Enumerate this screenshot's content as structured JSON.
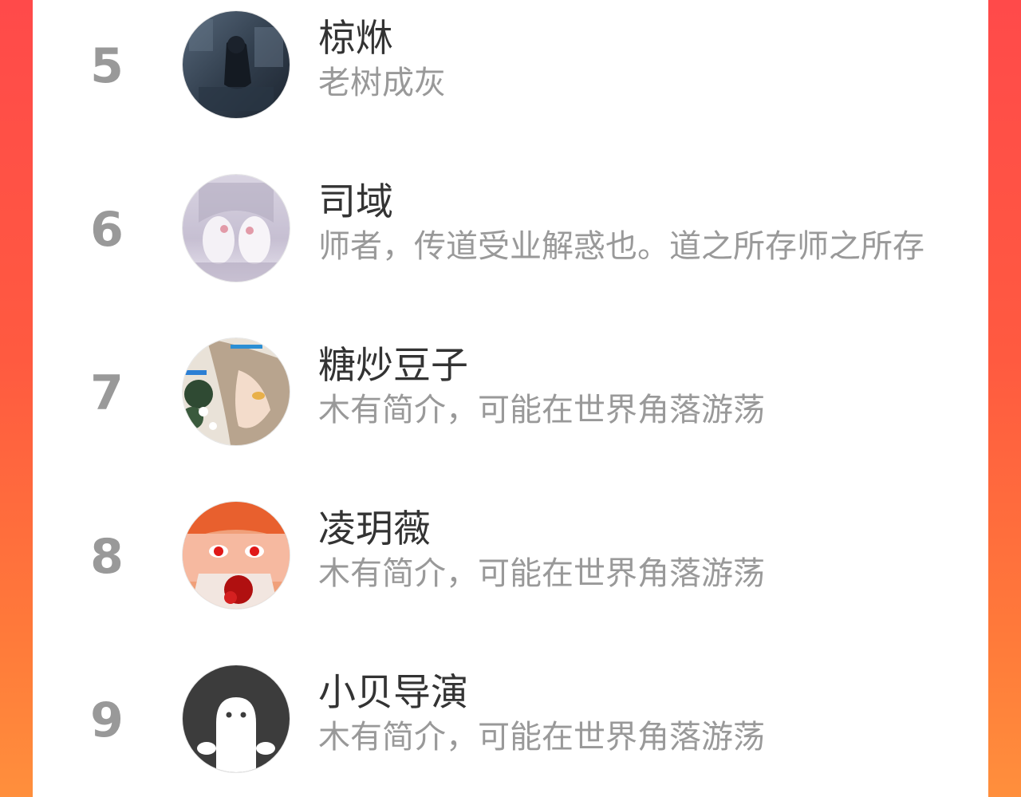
{
  "colors": {
    "background_gradient_start": "#ff4a4a",
    "background_gradient_end": "#ff8f3c",
    "panel": "#ffffff",
    "name_text": "#333333",
    "bio_text": "#999999",
    "rank_text": "#999999"
  },
  "ranking": {
    "items": [
      {
        "rank": "5",
        "name": "椋烌",
        "bio": "老树成灰",
        "avatar": "dark-blue-illustration-avatar"
      },
      {
        "rank": "6",
        "name": "司域",
        "bio": "师者，传道受业解惑也。道之所存师之所存",
        "avatar": "pale-white-illustration-avatar"
      },
      {
        "rank": "7",
        "name": "糖炒豆子",
        "bio": "木有简介，可能在世界角落游荡",
        "avatar": "anime-girl-flowers-avatar"
      },
      {
        "rank": "8",
        "name": "凌玥薇",
        "bio": "木有简介，可能在世界角落游荡",
        "avatar": "red-eyed-anime-avatar"
      },
      {
        "rank": "9",
        "name": "小贝导演",
        "bio": "木有简介，可能在世界角落游荡",
        "avatar": "default-ghost-avatar"
      }
    ]
  }
}
